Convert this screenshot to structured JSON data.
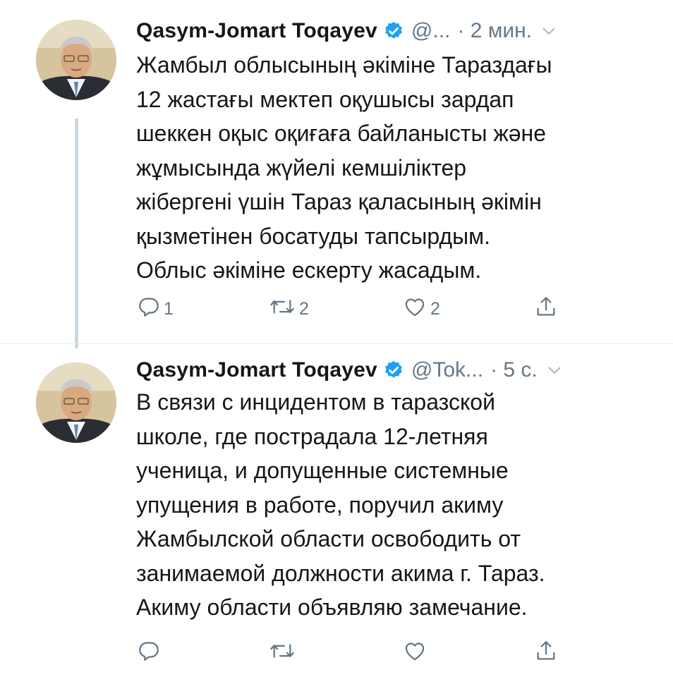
{
  "tweets": [
    {
      "author_name": "Qasym-Jomart Toqayev",
      "handle": "@...",
      "time": "· 2 мин.",
      "text": "Жамбыл облысының әкіміне Тараздағы\n12 жастағы мектеп оқушысы зардап\nшеккен оқыс оқиғаға байланысты және\nжұмысында жүйелі кемшіліктер\nжібергені үшін Тараз қаласының әкімін\nқызметінен босатуды тапсырдым.\nОблыс әкіміне ескерту жасадым.",
      "reply_count": "1",
      "retweet_count": "2",
      "like_count": "2"
    },
    {
      "author_name": "Qasym-Jomart Toqayev",
      "handle": "@Tok...",
      "time": "· 5 с.",
      "text": "В связи с инцидентом в таразской\nшколе, где пострадала 12-летняя\nученица, и допущенные системные\nупущения в работе, поручил акиму\nЖамбылской области освободить от\nзанимаемой должности акима г. Тараз.\nАкиму области объявляю замечание.",
      "reply_count": "",
      "retweet_count": "",
      "like_count": ""
    }
  ],
  "icons": {
    "verified": "verified-badge-icon",
    "reply": "reply-icon",
    "retweet": "retweet-icon",
    "like": "heart-icon",
    "share": "share-icon",
    "more": "chevron-down-icon"
  },
  "colors": {
    "text": "#14171a",
    "secondary": "#657786",
    "verified": "#1da1f2",
    "thread_line": "#ccd6dd"
  }
}
